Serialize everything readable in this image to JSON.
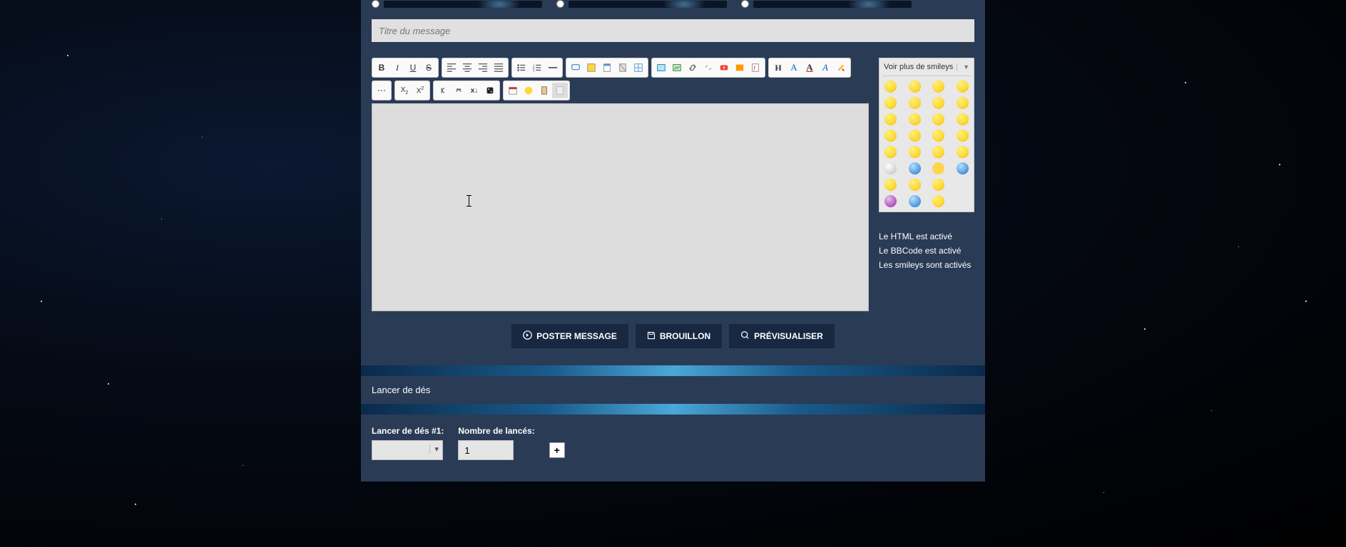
{
  "title_input": {
    "value": "",
    "placeholder": "Titre du message"
  },
  "smileys": {
    "header": "Voir plus de smileys",
    "items": [
      "😀",
      "😊",
      "😃",
      "🙂",
      "😎",
      "😍",
      "😮",
      "😏",
      "😁",
      "😄",
      "😺",
      "😈",
      "😂",
      "😝",
      "😤",
      "😅",
      "💡",
      "😇",
      "😐",
      "😶",
      "😨",
      "🤔",
      "💛",
      "🌀",
      "😬",
      "😵",
      "😡",
      "",
      "😰",
      "🥶",
      "😴",
      ""
    ]
  },
  "status": {
    "html": "Le HTML est activé",
    "bbcode": "Le BBCode est activé",
    "smileys": "Les smileys sont activés"
  },
  "buttons": {
    "post": "POSTER MESSAGE",
    "draft": "BROUILLON",
    "preview": "PRÉVISUALISER"
  },
  "dice": {
    "section_title": "Lancer de dés",
    "field1_label": "Lancer de dés #1:",
    "field1_value": "",
    "field2_label": "Nombre de lancés:",
    "field2_value": "1",
    "plus": "+"
  },
  "toolbar_icons": {
    "bold": "B",
    "italic": "I",
    "underline": "U",
    "strike": "S"
  }
}
